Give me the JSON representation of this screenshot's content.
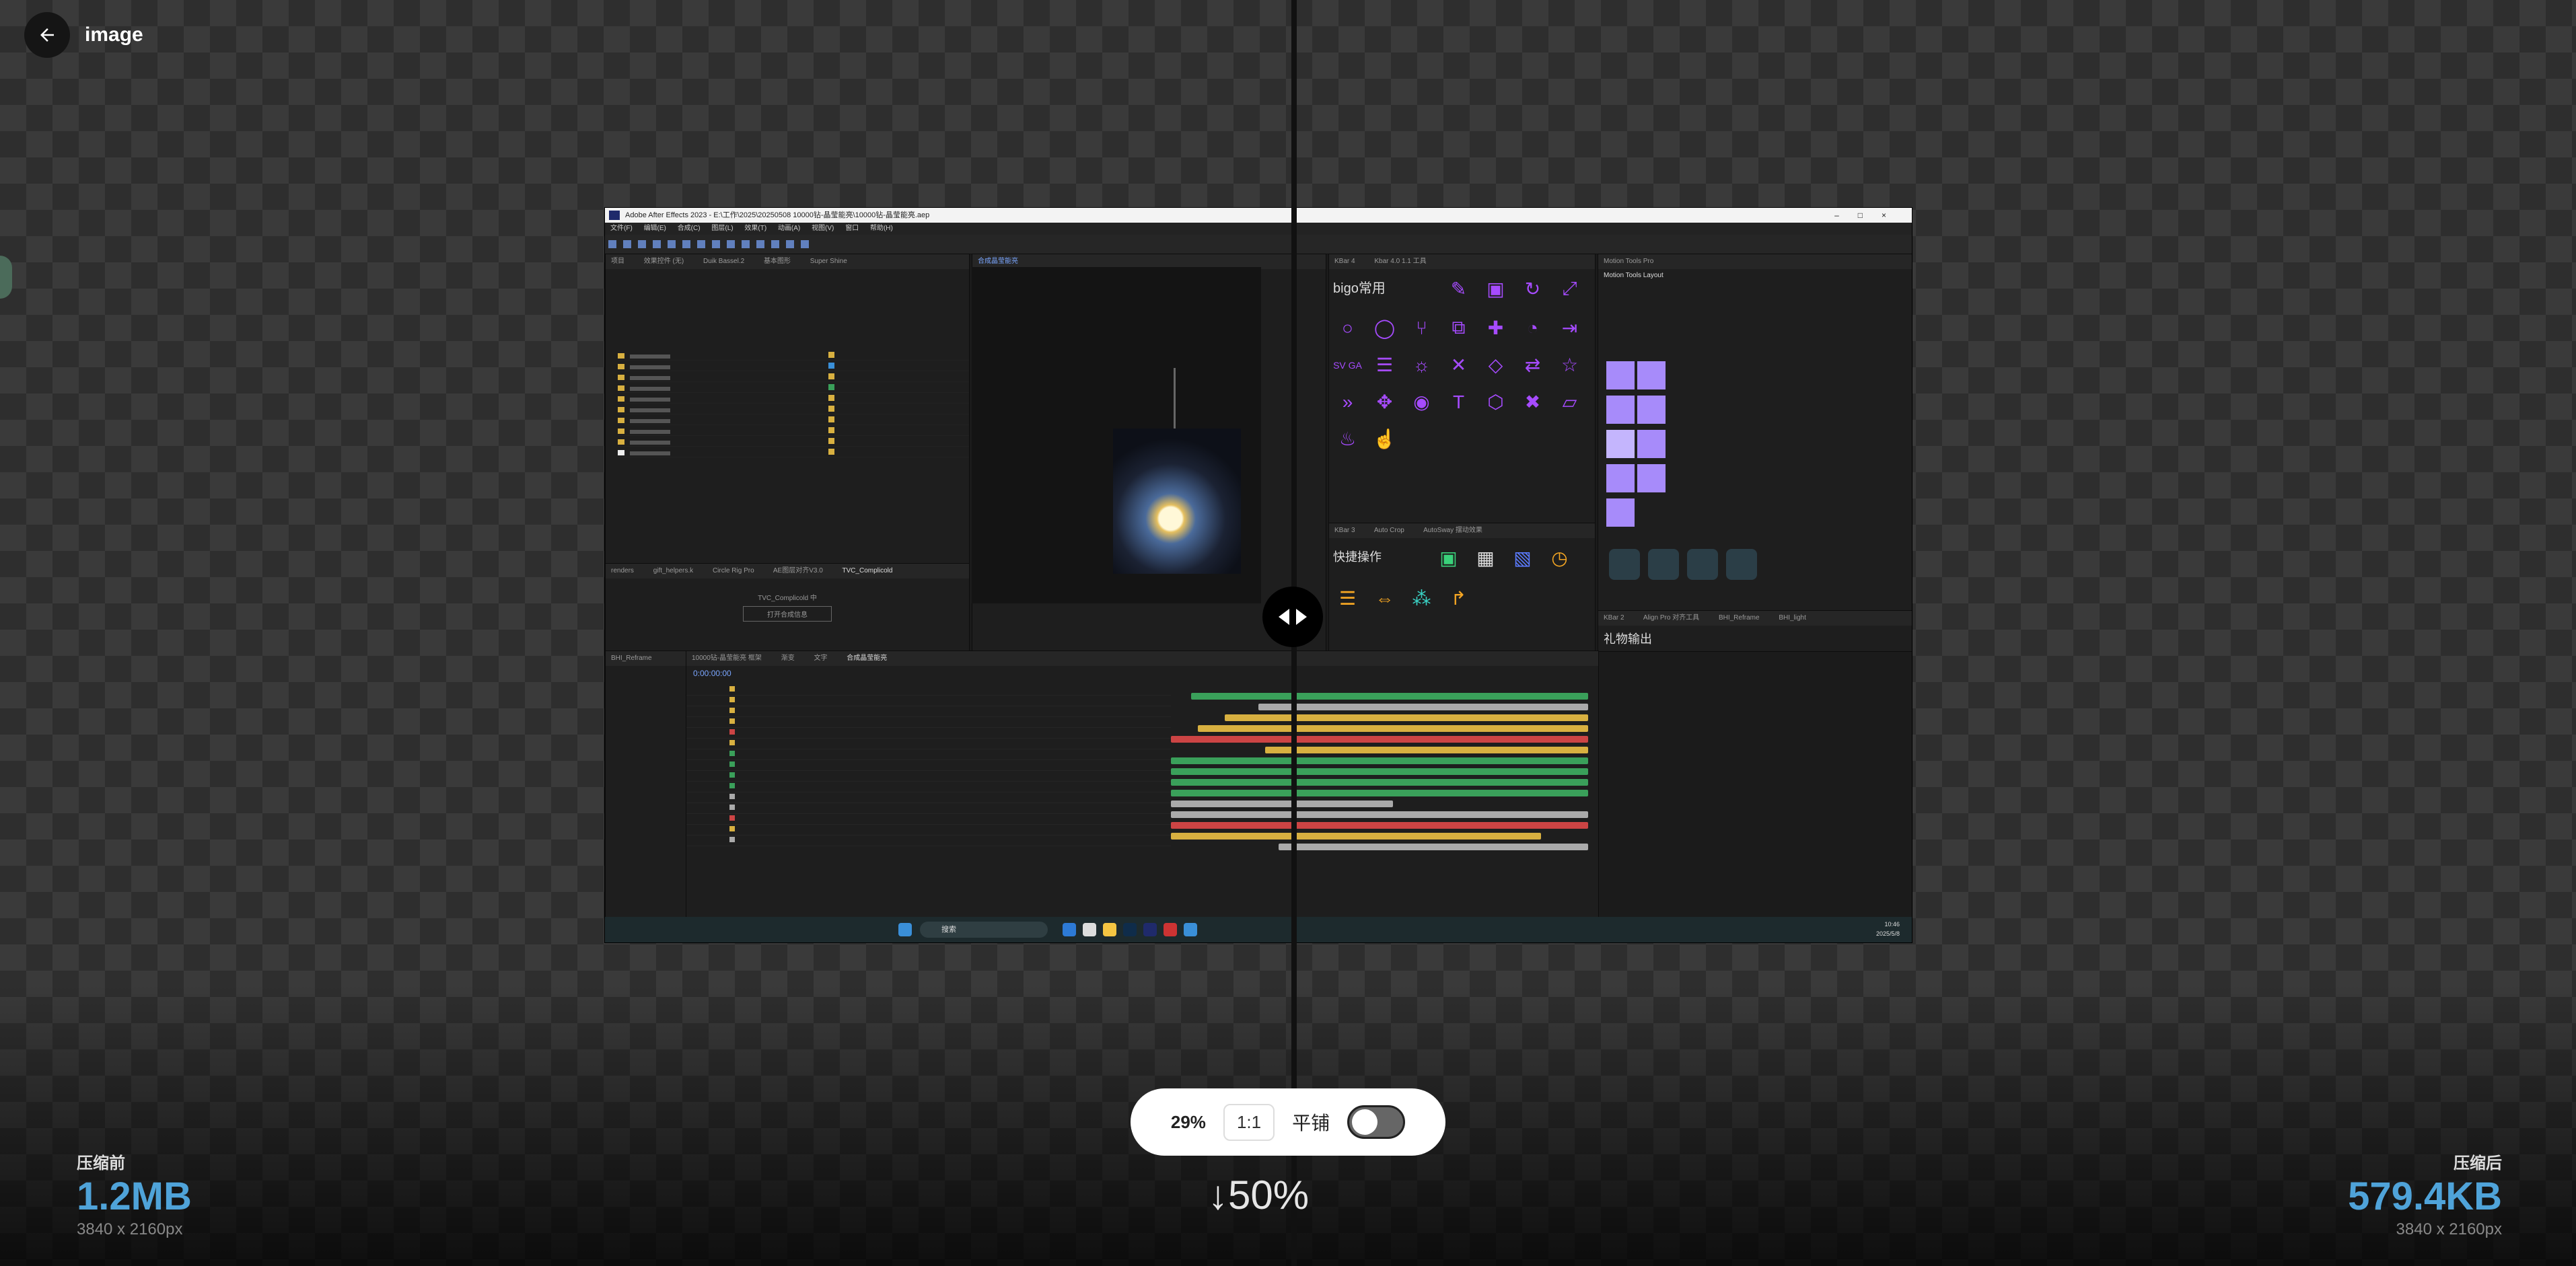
{
  "header": {
    "title": "image"
  },
  "screenshot": {
    "window_title": "Adobe After Effects 2023 - E:\\工作\\2025\\20250508 10000钻-晶莹能亮\\10000钻-晶莹能亮.aep",
    "menus": [
      "文件(F)",
      "编辑(E)",
      "合成(C)",
      "图层(L)",
      "效果(T)",
      "动画(A)",
      "视图(V)",
      "窗口",
      "帮助(H)"
    ],
    "panel_tabs": {
      "project": [
        "项目",
        "效果控件 (无)",
        "Duik Bassel.2",
        "基本图形",
        "Super Shine"
      ],
      "bottom_left": [
        "renders",
        "gift_helpers.k",
        "Circle Rig Pro",
        "AE图层对齐V3.0",
        "TVC_Complicold"
      ],
      "tvc_title": "TVC_Complicold 中",
      "tvc_button": "打开合成信息",
      "viewer_tab": "合成晶莹能亮",
      "kbar4": [
        "KBar 4",
        "Kbar 4.0 1.1 工具",
        "Motion Tools Pro"
      ],
      "kbar3": [
        "KBar 3",
        "Auto Crop",
        "AutoSway 摆动效果"
      ],
      "kbar2": [
        "KBar 2",
        "Align Pro 对齐工具",
        "BHI_Reframe",
        "BHI_light"
      ],
      "timeline": [
        "10000钻-晶莹能亮 框架",
        "渐变",
        "文字",
        "合成晶莹能亮"
      ]
    },
    "kbar_labels": {
      "bigo": "bigo常用",
      "quick": "快捷操作",
      "gift": "礼物输出",
      "motion_layout": "Motion Tools Layout",
      "svga": "SV GA"
    },
    "timecode": "0:00:00:00",
    "bhi_panel_title": "BHI_Reframe",
    "taskbar": {
      "search": "搜索",
      "time": "10:46",
      "date": "2025/5/8"
    }
  },
  "zoom": {
    "percent": "29%",
    "one_to_one": "1:1",
    "tile_label": "平铺",
    "tile_enabled": false
  },
  "before": {
    "label": "压缩前",
    "size": "1.2MB",
    "dims": "3840 x 2160px"
  },
  "after": {
    "label": "压缩后",
    "size": "579.4KB",
    "dims": "3840 x 2160px"
  },
  "reduction": "↓50%",
  "colors": {
    "accent_blue": "#4fa3d9",
    "kbar_purple": "#a64bff"
  }
}
